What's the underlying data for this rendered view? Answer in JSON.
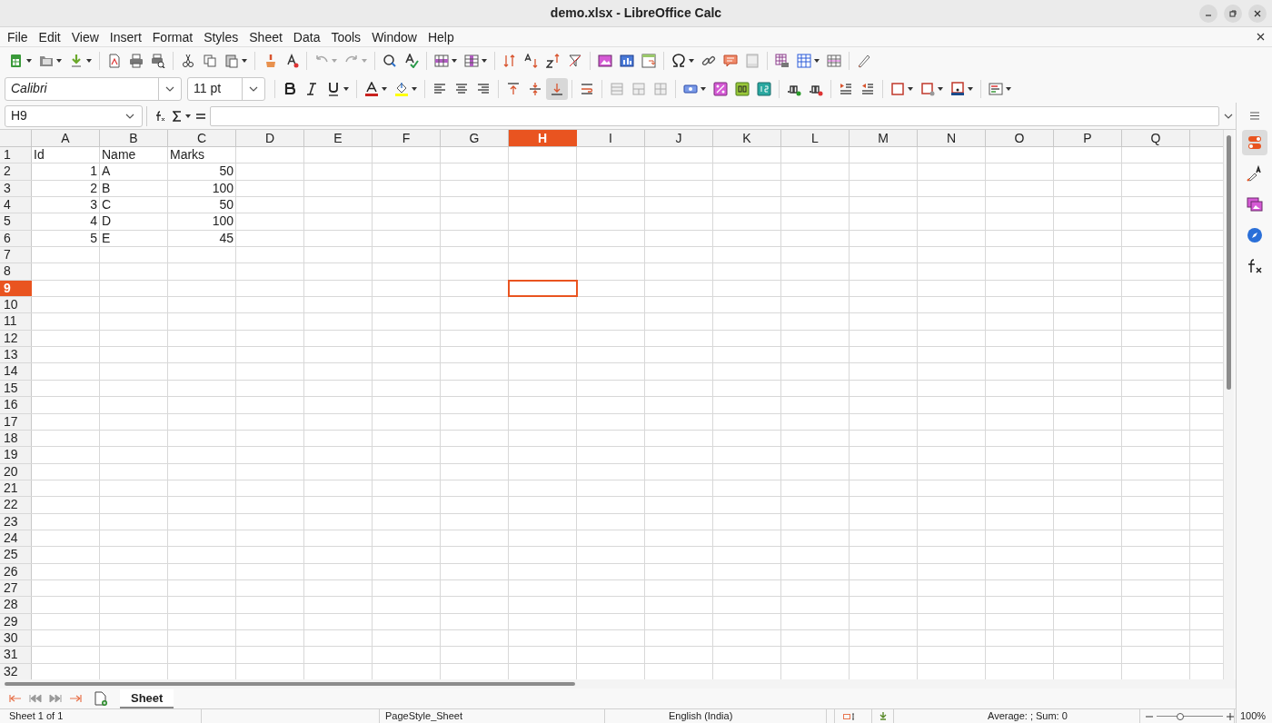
{
  "window": {
    "title": "demo.xlsx - LibreOffice Calc"
  },
  "menu": [
    "File",
    "Edit",
    "View",
    "Insert",
    "Format",
    "Styles",
    "Sheet",
    "Data",
    "Tools",
    "Window",
    "Help"
  ],
  "standard_toolbar": {
    "undo_disabled": true,
    "redo_disabled": true
  },
  "formatting_toolbar": {
    "font_name": "Calibri",
    "font_size": "11 pt",
    "align_bottom_pressed": true
  },
  "formula_bar": {
    "name_box": "H9"
  },
  "columns": [
    {
      "label": "A",
      "selected": false
    },
    {
      "label": "B",
      "selected": false
    },
    {
      "label": "C",
      "selected": false
    },
    {
      "label": "D",
      "selected": false
    },
    {
      "label": "E",
      "selected": false
    },
    {
      "label": "F",
      "selected": false
    },
    {
      "label": "G",
      "selected": false
    },
    {
      "label": "H",
      "selected": true
    },
    {
      "label": "I",
      "selected": false
    },
    {
      "label": "J",
      "selected": false
    },
    {
      "label": "K",
      "selected": false
    },
    {
      "label": "L",
      "selected": false
    },
    {
      "label": "M",
      "selected": false
    },
    {
      "label": "N",
      "selected": false
    },
    {
      "label": "O",
      "selected": false
    },
    {
      "label": "P",
      "selected": false
    },
    {
      "label": "Q",
      "selected": false
    }
  ],
  "rows": [
    {
      "number": "1",
      "selected": false,
      "cells": [
        {
          "text": "Id",
          "kind": "text"
        },
        {
          "text": "Name",
          "kind": "text"
        },
        {
          "text": "Marks",
          "kind": "text"
        }
      ]
    },
    {
      "number": "2",
      "selected": false,
      "cells": [
        {
          "text": "1",
          "kind": "number"
        },
        {
          "text": "A",
          "kind": "text"
        },
        {
          "text": "50",
          "kind": "number"
        }
      ]
    },
    {
      "number": "3",
      "selected": false,
      "cells": [
        {
          "text": "2",
          "kind": "number"
        },
        {
          "text": "B",
          "kind": "text"
        },
        {
          "text": "100",
          "kind": "number"
        }
      ]
    },
    {
      "number": "4",
      "selected": false,
      "cells": [
        {
          "text": "3",
          "kind": "number"
        },
        {
          "text": "C",
          "kind": "text"
        },
        {
          "text": "50",
          "kind": "number"
        }
      ]
    },
    {
      "number": "5",
      "selected": false,
      "cells": [
        {
          "text": "4",
          "kind": "number"
        },
        {
          "text": "D",
          "kind": "text"
        },
        {
          "text": "100",
          "kind": "number"
        }
      ]
    },
    {
      "number": "6",
      "selected": false,
      "cells": [
        {
          "text": "5",
          "kind": "number"
        },
        {
          "text": "E",
          "kind": "text"
        },
        {
          "text": "45",
          "kind": "number"
        }
      ]
    },
    {
      "number": "7",
      "selected": false
    },
    {
      "number": "8",
      "selected": false
    },
    {
      "number": "9",
      "selected": true
    },
    {
      "number": "10",
      "selected": false
    },
    {
      "number": "11",
      "selected": false
    },
    {
      "number": "12",
      "selected": false
    },
    {
      "number": "13",
      "selected": false
    },
    {
      "number": "14",
      "selected": false
    },
    {
      "number": "15",
      "selected": false
    },
    {
      "number": "16",
      "selected": false
    },
    {
      "number": "17",
      "selected": false
    },
    {
      "number": "18",
      "selected": false
    },
    {
      "number": "19",
      "selected": false
    },
    {
      "number": "20",
      "selected": false
    },
    {
      "number": "21",
      "selected": false
    },
    {
      "number": "22",
      "selected": false
    },
    {
      "number": "23",
      "selected": false
    },
    {
      "number": "24",
      "selected": false
    },
    {
      "number": "25",
      "selected": false
    },
    {
      "number": "26",
      "selected": false
    },
    {
      "number": "27",
      "selected": false
    },
    {
      "number": "28",
      "selected": false
    },
    {
      "number": "29",
      "selected": false
    },
    {
      "number": "30",
      "selected": false
    },
    {
      "number": "31",
      "selected": false
    },
    {
      "number": "32",
      "selected": false
    }
  ],
  "sheet_tabs": [
    {
      "label": "Sheet",
      "selected": true
    }
  ],
  "sidebar_tabs": [
    {
      "selected": true
    },
    {
      "selected": false
    },
    {
      "selected": false
    },
    {
      "selected": false
    },
    {
      "selected": false
    }
  ],
  "status_bar": {
    "sheet": "Sheet 1 of 1",
    "page_style": "PageStyle_Sheet",
    "language": "English (India)",
    "summary": "Average: ; Sum: 0",
    "zoom": {
      "level": 0.35
    },
    "zoom_percent": "100%"
  }
}
